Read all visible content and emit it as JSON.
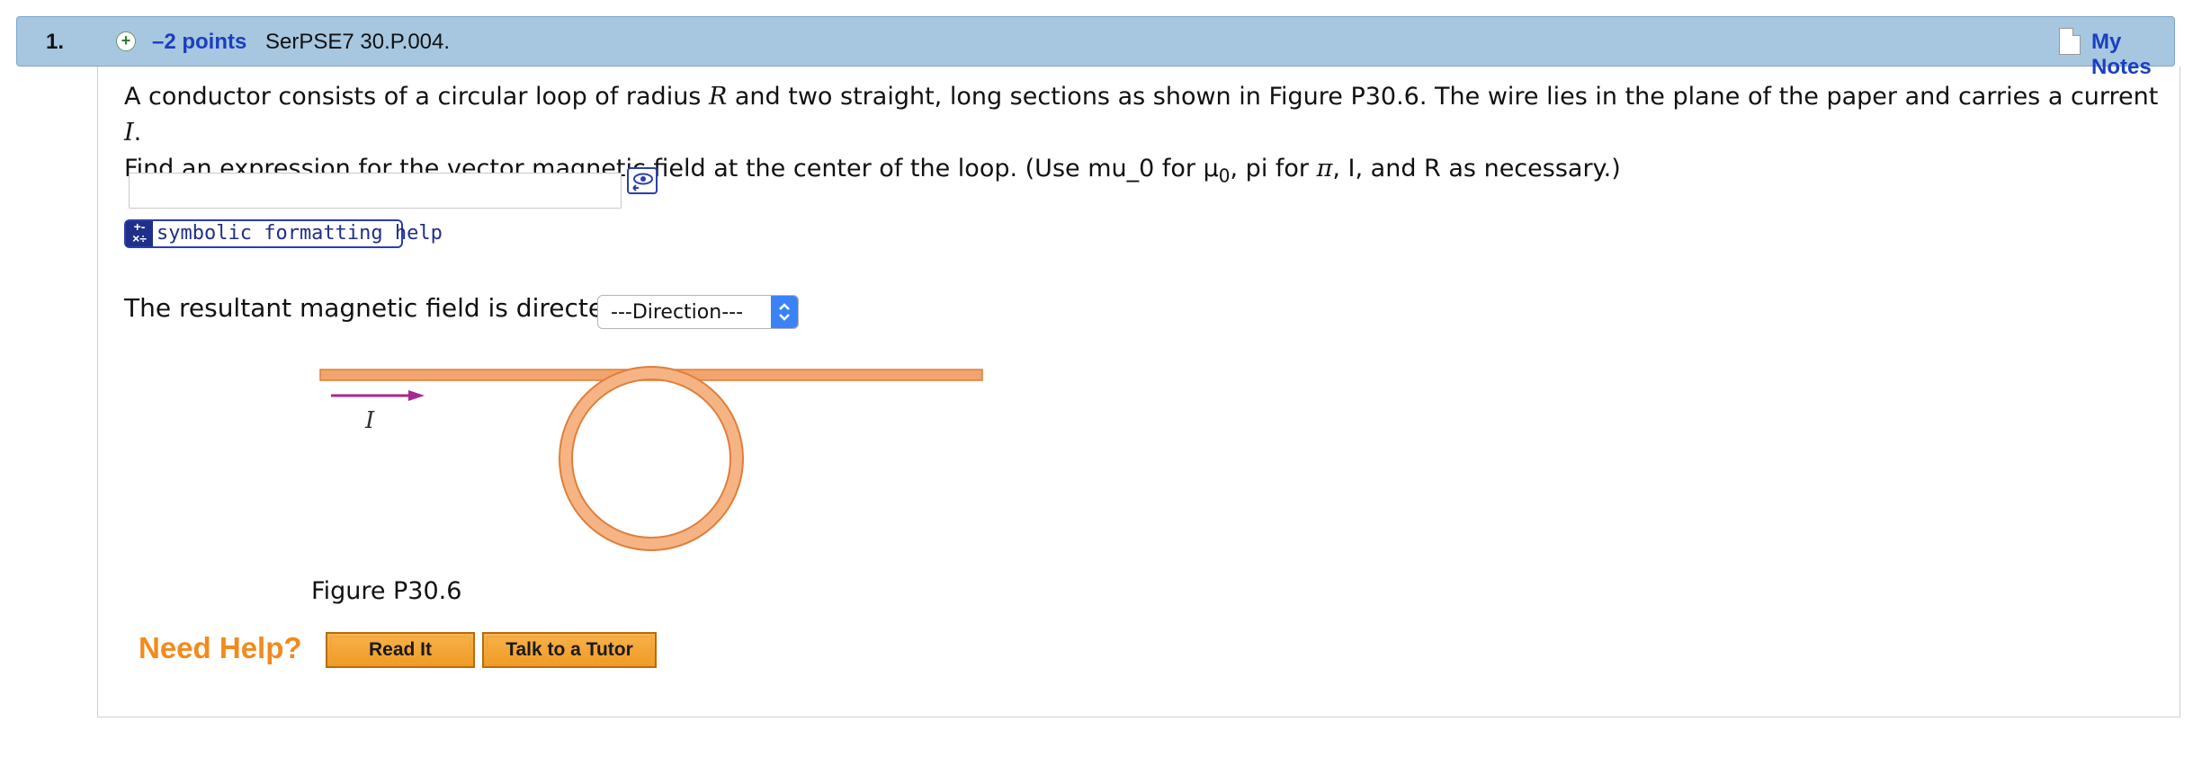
{
  "header": {
    "number": "1.",
    "points": "–2 points",
    "question_id": "SerPSE7 30.P.004.",
    "my_notes": "My Notes"
  },
  "question": {
    "line1_a": "A conductor consists of a circular loop of radius ",
    "line1_r": "R",
    "line1_b": " and two straight, long sections as shown in Figure P30.6. The wire lies in the plane of the paper and carries a current ",
    "line1_i": "I",
    "line1_c": ".",
    "line2_a": "Find an expression for the vector magnetic field at the center of the loop. (Use mu_0 for μ",
    "line2_sub": "0",
    "line2_b": ", pi for ",
    "line2_pi": "π",
    "line2_c": ", I, and R as necessary.)"
  },
  "answer": {
    "value": "",
    "symbolic_help": "symbolic formatting help"
  },
  "direction": {
    "prompt": "The resultant magnetic field is directed",
    "selected": "---Direction---"
  },
  "figure": {
    "current_label": "I",
    "caption": "Figure P30.6",
    "wire_color": "#f2a46d"
  },
  "help": {
    "need_help": "Need Help?",
    "read_it": "Read It",
    "talk_to_tutor": "Talk to a Tutor"
  },
  "colors": {
    "header_bg": "#a7c6e0",
    "link": "#1a3fc0",
    "accent_orange": "#f28a1d",
    "arrow": "#a62a8f"
  },
  "icons": [
    "plus-circle-icon",
    "notes-page-icon",
    "eye-preview-icon",
    "symbolic-format-icon",
    "select-arrows-icon",
    "current-arrow-icon"
  ]
}
